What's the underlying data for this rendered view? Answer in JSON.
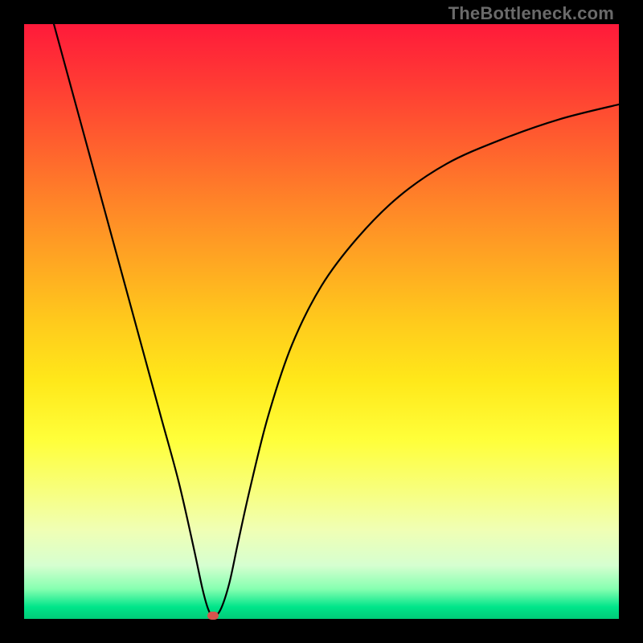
{
  "watermark": "TheBottleneck.com",
  "chart_data": {
    "type": "line",
    "title": "",
    "xlabel": "",
    "ylabel": "",
    "xlim": [
      0,
      100
    ],
    "ylim": [
      0,
      100
    ],
    "grid": false,
    "legend": false,
    "background": "rainbow-vertical-red-to-green",
    "series": [
      {
        "name": "bottleneck-curve",
        "color": "#000000",
        "x": [
          5,
          8,
          11,
          14,
          17,
          20,
          23,
          26,
          28.5,
          30,
          31,
          31.8,
          33,
          34.5,
          36,
          38,
          41,
          45,
          50,
          56,
          63,
          71,
          80,
          90,
          100
        ],
        "y": [
          100,
          89,
          78,
          67,
          56,
          45,
          34,
          23,
          12,
          5,
          1.5,
          0.5,
          1.5,
          6,
          13,
          22,
          34,
          46,
          56,
          64,
          71,
          76.5,
          80.5,
          84,
          86.5
        ]
      }
    ],
    "marker": {
      "name": "optimal-point",
      "x": 31.8,
      "y": 0.5,
      "color": "#d9544d"
    }
  }
}
